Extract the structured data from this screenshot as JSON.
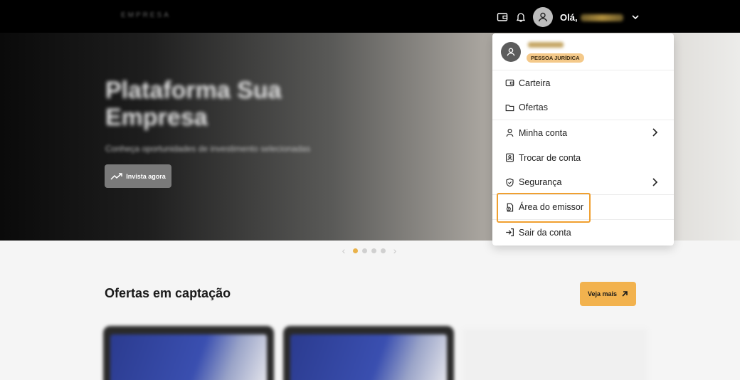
{
  "topbar": {
    "logo": "EMPRESA",
    "greeting": "Olá,",
    "icons": [
      "wallet-icon",
      "bell-icon",
      "user-icon",
      "chevron-down-icon"
    ]
  },
  "hero": {
    "title": "Plataforma Sua Empresa",
    "subtitle": "Conheça oportunidades de investimento selecionadas",
    "cta_label": "Invista agora"
  },
  "carousel": {
    "slides": 4,
    "active_index": 0
  },
  "offers": {
    "title": "Ofertas em captação",
    "more_label": "Veja mais"
  },
  "dropdown": {
    "badge": "PESSOA JURÍDICA",
    "items": [
      {
        "label": "Carteira",
        "icon": "wallet-icon"
      },
      {
        "label": "Ofertas",
        "icon": "folder-icon"
      },
      {
        "label": "Minha conta",
        "icon": "user-icon"
      },
      {
        "label": "Trocar de conta",
        "icon": "id-card-icon"
      },
      {
        "label": "Segurança",
        "icon": "shield-icon"
      },
      {
        "label": "Área do emissor",
        "icon": "emitter-icon"
      },
      {
        "label": "Sair da conta",
        "icon": "logout-icon"
      }
    ]
  },
  "colors": {
    "accent": "#f2b24e",
    "highlight_border": "#f0a030",
    "badge_bg": "#f4c98a"
  }
}
